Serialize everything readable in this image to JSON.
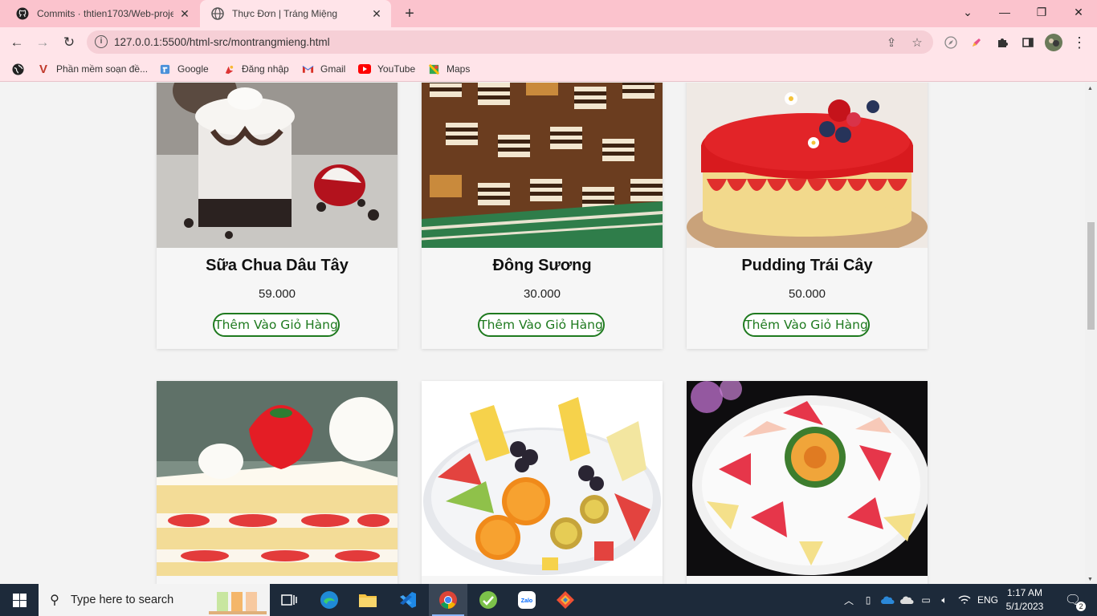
{
  "browser": {
    "tabs": [
      {
        "title": "Commits · thtien1703/Web-proje",
        "icon": "github-icon",
        "active": false
      },
      {
        "title": "Thực Đơn | Tráng Miệng",
        "icon": "globe-icon",
        "active": true
      }
    ],
    "url": "127.0.0.1:5500/html-src/montrangmieng.html",
    "bookmarks": [
      {
        "label": "Phần mềm soạn đề...",
        "icon": "v-logo-icon"
      },
      {
        "label": "Google",
        "icon": "google-icon"
      },
      {
        "label": "Đăng nhập",
        "icon": "login-icon"
      },
      {
        "label": "Gmail",
        "icon": "gmail-icon"
      },
      {
        "label": "YouTube",
        "icon": "youtube-icon"
      },
      {
        "label": "Maps",
        "icon": "maps-icon"
      }
    ]
  },
  "menu": {
    "add_to_cart": "Thêm Vào Giỏ Hàng",
    "items": [
      {
        "name": "Sữa Chua Dâu Tây",
        "price": "59.000",
        "image": "strawberry-yogurt-jar"
      },
      {
        "name": "Đông Sương",
        "price": "30.000",
        "image": "layered-jelly"
      },
      {
        "name": "Pudding Trái Cây",
        "price": "50.000",
        "image": "fruit-mousse-cake"
      },
      {
        "name": "",
        "price": "",
        "image": "strawberry-shortcake"
      },
      {
        "name": "",
        "price": "",
        "image": "fruit-platter"
      },
      {
        "name": "",
        "price": "",
        "image": "fruit-plate-dark"
      }
    ]
  },
  "taskbar": {
    "search_placeholder": "Type here to search",
    "language": "ENG",
    "time": "1:17 AM",
    "date": "5/1/2023",
    "notifications": "2"
  },
  "colors": {
    "tabbar": "#fbc3cd",
    "toolbar": "#ffe4e9",
    "button_accent": "#1f7a1f",
    "taskbar": "#1d2a3a"
  }
}
